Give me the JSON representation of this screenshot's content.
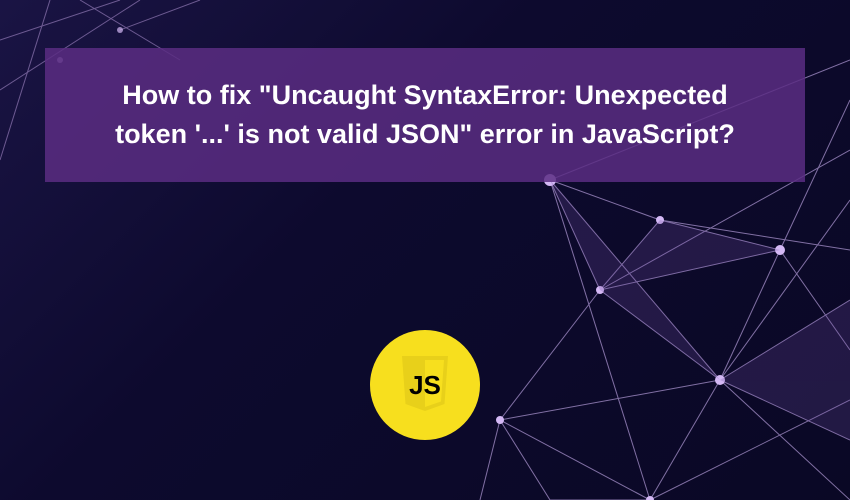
{
  "title": "How to fix \"Uncaught SyntaxError: Unexpected token '...' is not valid JSON\" error in JavaScript?",
  "logo": {
    "name": "javascript-logo",
    "text": "JS",
    "bg_color": "#f7df1e",
    "text_color": "#000000"
  },
  "colors": {
    "background_start": "#1a1444",
    "background_end": "#0a0825",
    "title_box_bg": "#5a2d82",
    "network_lines": "#b49cd9",
    "network_nodes": "#c9a3ff"
  }
}
